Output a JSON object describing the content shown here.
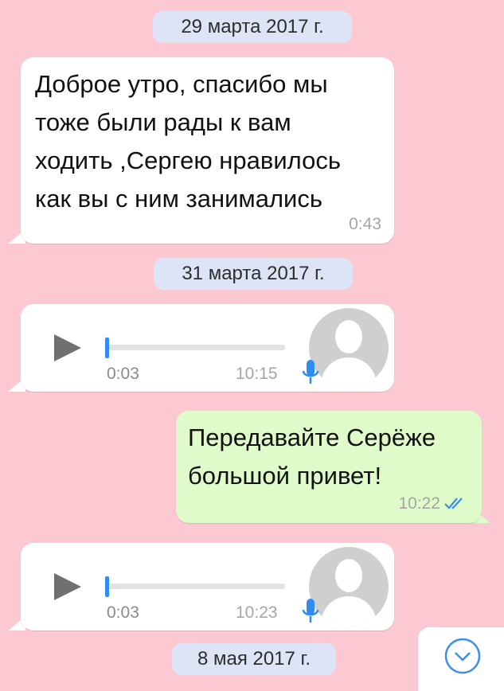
{
  "dates": {
    "d1": "29 марта 2017 г.",
    "d2": "31 марта 2017 г.",
    "d3": "8 мая 2017 г."
  },
  "messages": {
    "m1": {
      "text": "Доброе утро, спасибо мы\nтоже были рады к вам\nходить ,Сергею нравилось\nкак вы с ним занимались",
      "time": "0:43"
    },
    "voice1": {
      "duration": "0:03",
      "time": "10:15",
      "progress": 0
    },
    "m2": {
      "text": "Передавайте Серёже\nбольшой привет!",
      "time": "10:22",
      "status": "read"
    },
    "voice2": {
      "duration": "0:03",
      "time": "10:23",
      "progress": 0
    }
  },
  "icons": {
    "play": "play-icon",
    "mic": "microphone-icon",
    "avatar": "avatar-placeholder",
    "read": "double-check-icon",
    "scroll": "chevron-down-icon"
  },
  "colors": {
    "background": "#fcc8d2",
    "incoming": "#ffffff",
    "outgoing": "#e0fbca",
    "accent": "#2f8cf0"
  }
}
